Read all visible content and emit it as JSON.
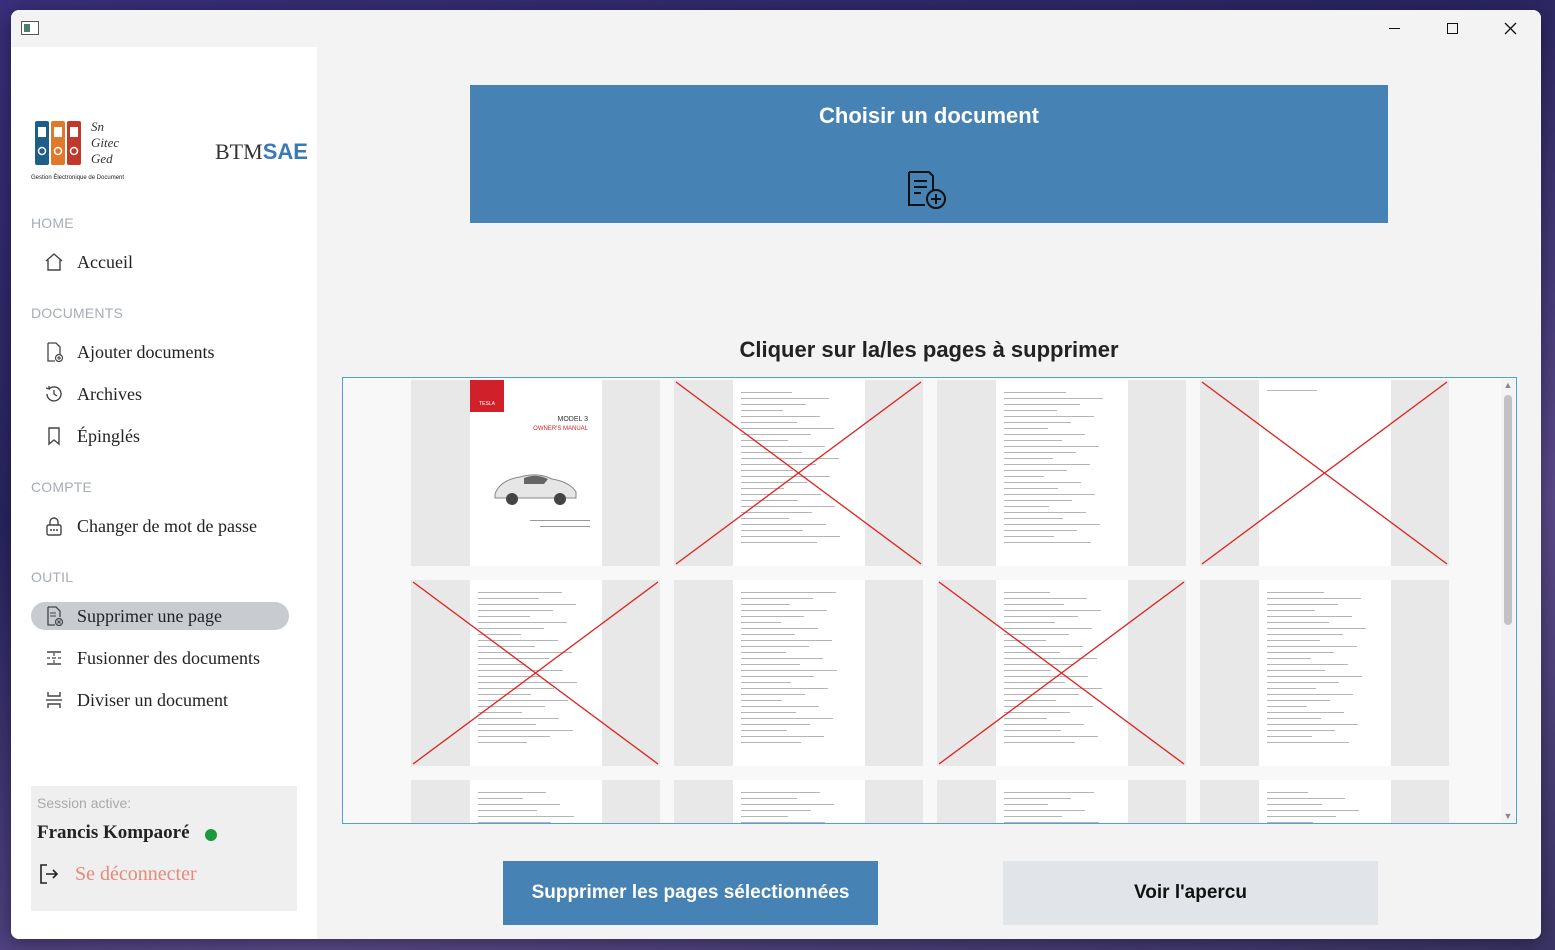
{
  "window": {
    "min_icon": "minimize-icon",
    "max_icon": "maximize-icon",
    "close_icon": "close-icon"
  },
  "sidebar": {
    "brand_prefix": "BTM",
    "brand_accent": "SAE",
    "logo_text": "Sn\nGitec\nGed",
    "logo_caption": "Gestion Électronique de Document",
    "sections": {
      "home": "HOME",
      "documents": "DOCUMENTS",
      "compte": "COMPTE",
      "outil": "OUTIL"
    },
    "items": {
      "accueil": "Accueil",
      "ajouter": "Ajouter documents",
      "archives": "Archives",
      "epingles": "Épinglés",
      "changer_mdp": "Changer de mot de passe",
      "supprimer": "Supprimer une page",
      "fusionner": "Fusionner des documents",
      "diviser": "Diviser un document"
    },
    "active_item": "supprimer",
    "session": {
      "label": "Session active:",
      "user": "Francis Kompaoré",
      "status_color": "#1a9a3a",
      "logout": "Se déconnecter"
    }
  },
  "main": {
    "choose_title": "Choisir un document",
    "choose_icon": "document-add-icon",
    "instruction": "Cliquer sur la/les pages à supprimer",
    "pages": [
      {
        "page": 1,
        "selected": false,
        "kind": "cover",
        "brand": "TESLA",
        "title": "MODEL 3",
        "subtitle": "OWNER'S MANUAL"
      },
      {
        "page": 2,
        "selected": true,
        "kind": "text"
      },
      {
        "page": 3,
        "selected": false,
        "kind": "contents"
      },
      {
        "page": 4,
        "selected": true,
        "kind": "blank"
      },
      {
        "page": 5,
        "selected": true,
        "kind": "interior"
      },
      {
        "page": 6,
        "selected": false,
        "kind": "exterior"
      },
      {
        "page": 7,
        "selected": true,
        "kind": "icons"
      },
      {
        "page": 8,
        "selected": false,
        "kind": "icons"
      },
      {
        "page": 9,
        "selected": false,
        "kind": "text"
      },
      {
        "page": 10,
        "selected": false,
        "kind": "text"
      },
      {
        "page": 11,
        "selected": false,
        "kind": "photo"
      },
      {
        "page": 12,
        "selected": false,
        "kind": "text"
      }
    ],
    "delete_button": "Supprimer les pages sélectionnées",
    "preview_button": "Voir l'apercu"
  },
  "colors": {
    "accent": "#4682b4",
    "selection_mark": "#e02020",
    "frame_border": "#4ea3d6"
  }
}
